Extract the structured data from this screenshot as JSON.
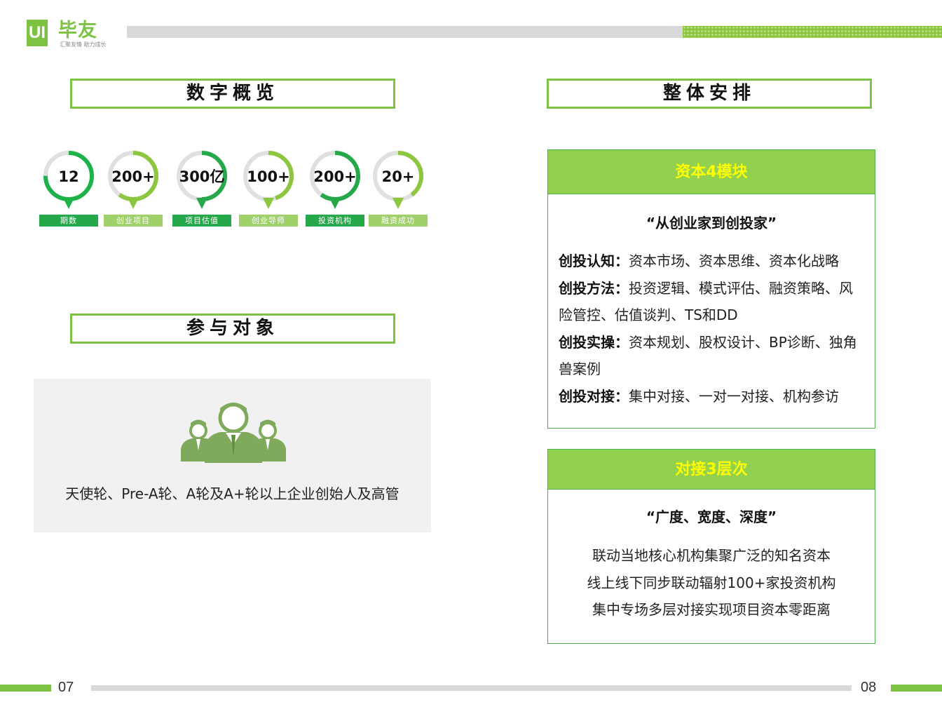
{
  "logo": {
    "mark": "UI",
    "name": "毕友",
    "slogan": "汇聚友情 助力成长"
  },
  "left": {
    "overview_title": "数字概览",
    "stats": [
      {
        "value": "12",
        "label": "期数",
        "fill": 0.75
      },
      {
        "value": "200+",
        "label": "创业项目",
        "fill": 0.6
      },
      {
        "value": "300亿",
        "label": "项目估值",
        "fill": 0.5
      },
      {
        "value": "100+",
        "label": "创业导师",
        "fill": 0.45
      },
      {
        "value": "200+",
        "label": "投资机构",
        "fill": 0.6
      },
      {
        "value": "20+",
        "label": "融资成功",
        "fill": 0.4
      }
    ],
    "participants_title": "参与对象",
    "participants_icon": "people-group-icon",
    "participants_text": "天使轮、Pre-A轮、A轮及A+轮以上企业创始人及高管"
  },
  "right": {
    "title": "整体安排",
    "module_box": {
      "header": "资本4模块",
      "quote": "“从创业家到创投家”",
      "items": [
        {
          "key": "创投认知：",
          "value": "资本市场、资本思维、资本化战略"
        },
        {
          "key": "创投方法：",
          "value": "投资逻辑、模式评估、融资策略、风险管控、估值谈判、TS和DD"
        },
        {
          "key": "创投实操：",
          "value": "资本规划、股权设计、BP诊断、独角兽案例"
        },
        {
          "key": "创投对接：",
          "value": "集中对接、一对一对接、机构参访"
        }
      ]
    },
    "level_box": {
      "header": "对接3层次",
      "quote": "“广度、宽度、深度”",
      "lines": [
        "联动当地核心机构集聚广泛的知名资本",
        "线上线下同步联动辐射100+家投资机构",
        "集中专场多层对接实现项目资本零距离"
      ]
    }
  },
  "footer": {
    "left_page": "07",
    "right_page": "08"
  },
  "colors": {
    "green": "#7dc243",
    "light_green": "#92d050",
    "dark_green": "#25a84a",
    "ring_track": "#e0e0e0",
    "header_text": "#ffff00"
  }
}
